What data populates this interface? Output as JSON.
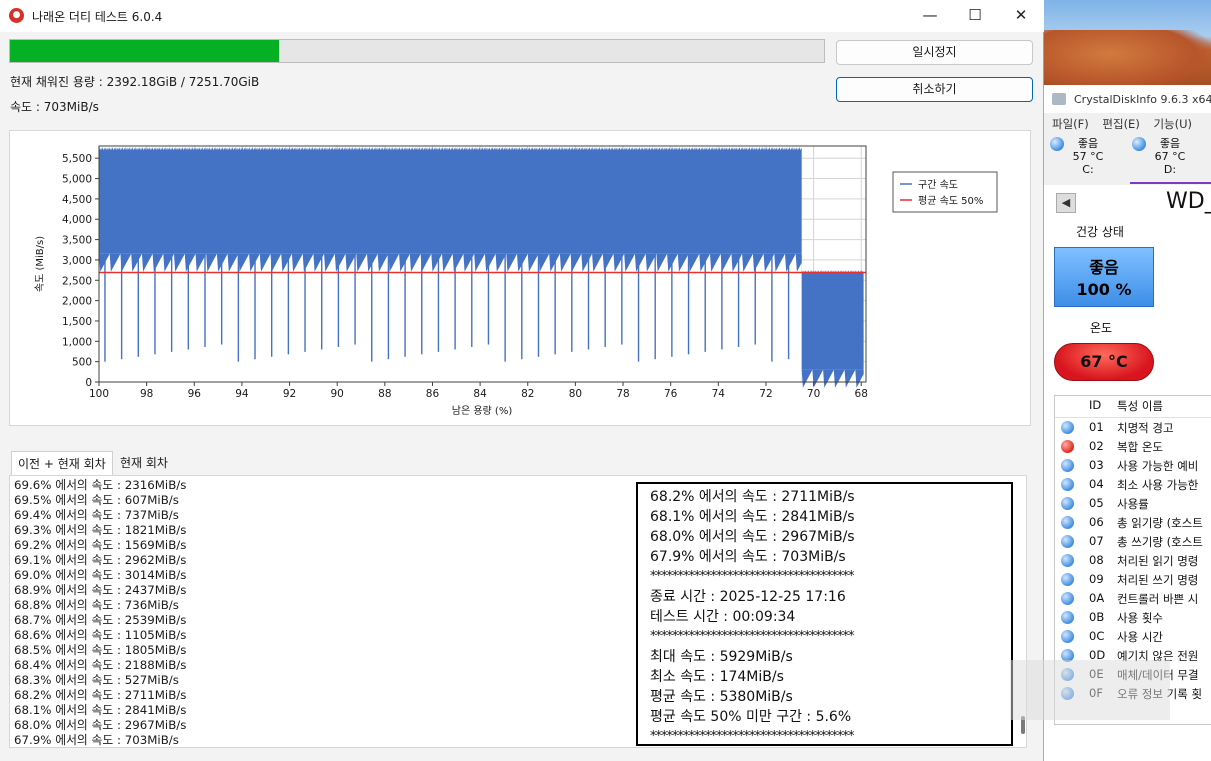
{
  "main_window": {
    "title": "나래온 더티 테스트 6.0.4",
    "progress": 0.33,
    "progress_color": "#06b025",
    "pause_label": "일시정지",
    "cancel_label": "취소하기",
    "filled_capacity": "현재 채워진 용량 : 2392.18GiB / 7251.70GiB",
    "speed": "속도 : 703MiB/s",
    "window_controls": {
      "minimize": "—",
      "maximize": "☐",
      "close": "✕"
    }
  },
  "chart_data": {
    "type": "line",
    "xlabel": "남은 용량 (%)",
    "ylabel": "속도 (MiB/s)",
    "x_ticks": [
      "100",
      "98",
      "96",
      "94",
      "92",
      "90",
      "88",
      "86",
      "84",
      "82",
      "80",
      "78",
      "76",
      "74",
      "72",
      "70",
      "68"
    ],
    "y_ticks": [
      "0",
      "500",
      "1,000",
      "1,500",
      "2,000",
      "2,500",
      "3,000",
      "3,500",
      "4,000",
      "4,500",
      "5,000",
      "5,500"
    ],
    "xlim": [
      100,
      67.8
    ],
    "ylim": [
      0,
      5800
    ],
    "x_reversed": true,
    "grid": true,
    "legend_placement": "right",
    "series": [
      {
        "name": "구간 속도",
        "color": "#4472c4",
        "segments": [
          {
            "x_from": 100,
            "x_to": 70.5,
            "top": 5770,
            "floor": 3150,
            "dip_to": 500,
            "dip_every": 0.7
          },
          {
            "x_from": 70.5,
            "x_to": 67.9,
            "top": 2750,
            "floor": 300
          }
        ]
      },
      {
        "name": "평균 속도 50%",
        "color": "#e83030",
        "value": 2690
      }
    ]
  },
  "tabs": [
    {
      "label": "이전 + 현재 회차"
    },
    {
      "label": "현재 회차"
    }
  ],
  "log_lines": [
    "69.6% 에서의 속도 : 2316MiB/s",
    "69.5% 에서의 속도 : 607MiB/s",
    "69.4% 에서의 속도 : 737MiB/s",
    "69.3% 에서의 속도 : 1821MiB/s",
    "69.2% 에서의 속도 : 1569MiB/s",
    "69.1% 에서의 속도 : 2962MiB/s",
    "69.0% 에서의 속도 : 3014MiB/s",
    "68.9% 에서의 속도 : 2437MiB/s",
    "68.8% 에서의 속도 : 736MiB/s",
    "68.7% 에서의 속도 : 2539MiB/s",
    "68.6% 에서의 속도 : 1105MiB/s",
    "68.5% 에서의 속도 : 1805MiB/s",
    "68.4% 에서의 속도 : 2188MiB/s",
    "68.3% 에서의 속도 : 527MiB/s",
    "68.2% 에서의 속도 : 2711MiB/s",
    "68.1% 에서의 속도 : 2841MiB/s",
    "68.0% 에서의 속도 : 2967MiB/s",
    "67.9% 에서의 속도 : 703MiB/s"
  ],
  "summary": {
    "lines_top": [
      "68.2% 에서의 속도 : 2711MiB/s",
      "68.1% 에서의 속도 : 2841MiB/s",
      "68.0% 에서의 속도 : 2967MiB/s",
      "67.9% 에서의 속도 : 703MiB/s"
    ],
    "separator": "*************************************",
    "end_time": "종료 시간 : 2025-12-25 17:16",
    "test_time": "테스트 시간 : 00:09:34",
    "max_speed": "최대 속도 : 5929MiB/s",
    "min_speed": "최소 속도 : 174MiB/s",
    "avg_speed": "평균 속도 : 5380MiB/s",
    "below_half": "평균 속도 50% 미만 구간 : 5.6%"
  },
  "crystaldiskinfo": {
    "title": "CrystalDiskInfo 9.6.3 x64",
    "menu": [
      "파일(F)",
      "편집(E)",
      "기능(U)"
    ],
    "drives": [
      {
        "status": "좋음",
        "temp": "57 °C",
        "letter": "C:"
      },
      {
        "status": "좋음",
        "temp": "67 °C",
        "letter": "D:"
      }
    ],
    "model": "WD_",
    "health_label": "건강 상태",
    "health_status": "좋음",
    "health_percent": "100 %",
    "temp_label": "온도",
    "temperature": "67 °C",
    "table_headers": {
      "id": "ID",
      "name": "특성 이름"
    },
    "attributes": [
      {
        "id": "01",
        "name": "치명적 경고",
        "state": "good"
      },
      {
        "id": "02",
        "name": "복합 온도",
        "state": "bad"
      },
      {
        "id": "03",
        "name": "사용 가능한 예비",
        "state": "good"
      },
      {
        "id": "04",
        "name": "최소 사용 가능한",
        "state": "good"
      },
      {
        "id": "05",
        "name": "사용률",
        "state": "good"
      },
      {
        "id": "06",
        "name": "총 읽기량 (호스트",
        "state": "good"
      },
      {
        "id": "07",
        "name": "총 쓰기량 (호스트",
        "state": "good"
      },
      {
        "id": "08",
        "name": "처리된 읽기 명령",
        "state": "good"
      },
      {
        "id": "09",
        "name": "처리된 쓰기 명령",
        "state": "good"
      },
      {
        "id": "0A",
        "name": "컨트롤러 바쁜 시",
        "state": "good"
      },
      {
        "id": "0B",
        "name": "사용 횟수",
        "state": "good"
      },
      {
        "id": "0C",
        "name": "사용 시간",
        "state": "good"
      },
      {
        "id": "0D",
        "name": "예기치 않은 전원",
        "state": "good"
      },
      {
        "id": "0E",
        "name": "매체/데이터 무결",
        "state": "good"
      },
      {
        "id": "0F",
        "name": "오류 정보 기록 횟",
        "state": "good"
      }
    ]
  }
}
